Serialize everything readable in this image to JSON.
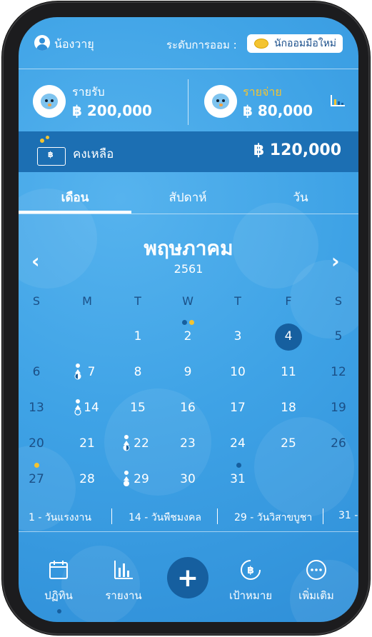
{
  "header": {
    "username": "น้องวายุ",
    "level_label": "ระดับการออม :",
    "level_value": "นักออมมือใหม่"
  },
  "summary": {
    "income_label": "รายรับ",
    "income_value": "฿ 200,000",
    "expense_label": "รายจ่าย",
    "expense_value": "฿ 80,000",
    "expense_label_color": "#f4c430"
  },
  "balance": {
    "label": "คงเหลือ",
    "value": "฿ 120,000",
    "wallet_glyph": "฿"
  },
  "tabs": [
    {
      "label": "เดือน",
      "active": true
    },
    {
      "label": "สัปดาห์",
      "active": false
    },
    {
      "label": "วัน",
      "active": false
    }
  ],
  "calendar": {
    "month": "พฤษภาคม",
    "year": "2561",
    "prev_glyph": "‹",
    "next_glyph": "›",
    "weekdays": [
      "S",
      "M",
      "T",
      "W",
      "T",
      "F",
      "S"
    ],
    "days": [
      "1",
      "2",
      "3",
      "4",
      "5",
      "6",
      "7",
      "8",
      "9",
      "10",
      "11",
      "12",
      "13",
      "14",
      "15",
      "16",
      "17",
      "18",
      "19",
      "20",
      "21",
      "22",
      "23",
      "24",
      "25",
      "26",
      "27",
      "28",
      "29",
      "30",
      "31"
    ],
    "selected_day": "4",
    "accent_dot_colors": {
      "blue": "#165f9f",
      "yellow": "#f4c430"
    }
  },
  "holidays": [
    "1 - วันแรงงาน",
    "14 - วันพืชมงคล",
    "29 - วันวิสาขบูชา",
    "31 -"
  ],
  "nav": {
    "items": [
      {
        "label": "ปฏิทิน",
        "icon": "calendar-icon"
      },
      {
        "label": "รายงาน",
        "icon": "bar-chart-icon"
      },
      {
        "label": "เป้าหมาย",
        "icon": "baht-target-icon"
      },
      {
        "label": "เพิ่มเติม",
        "icon": "more-icon"
      }
    ],
    "add_glyph": "+"
  }
}
